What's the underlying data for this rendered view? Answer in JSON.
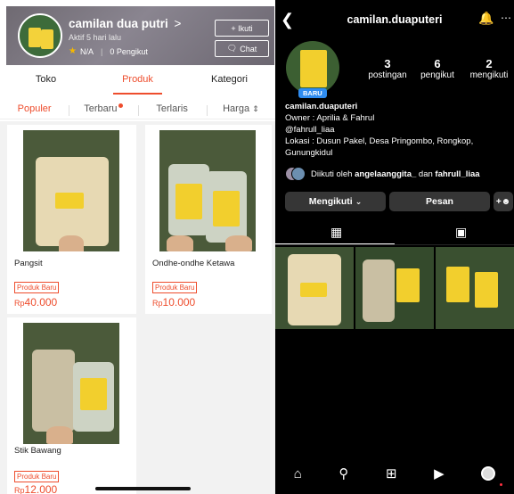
{
  "shopee": {
    "shop_name": "camilan dua putri",
    "name_chevron": ">",
    "active_status": "Aktif 5 hari lalu",
    "rating": "N/A",
    "followers": "0 Pengikut",
    "follow_button": "+ Ikuti",
    "chat_button": "Chat",
    "tabs": [
      "Toko",
      "Produk",
      "Kategori"
    ],
    "active_tab": "Produk",
    "sort_options": [
      "Populer",
      "Terbaru",
      "Terlaris",
      "Harga"
    ],
    "active_sort": "Populer",
    "products": [
      {
        "name": "Pangsit",
        "badge": "Produk Baru",
        "currency": "Rp",
        "price": "40.000"
      },
      {
        "name": "Ondhe-ondhe Ketawa",
        "badge": "Produk Baru",
        "currency": "Rp",
        "price": "10.000"
      },
      {
        "name": "Stik Bawang",
        "badge": "Produk Baru",
        "currency": "Rp",
        "price": "12.000"
      }
    ]
  },
  "instagram": {
    "username": "camilan.duaputeri",
    "avatar_badge": "BARU",
    "stats": [
      {
        "value": "3",
        "label": "postingan"
      },
      {
        "value": "6",
        "label": "pengikut"
      },
      {
        "value": "2",
        "label": "mengikuti"
      }
    ],
    "bio": {
      "name": "camilan.duaputeri",
      "line1": "Owner : Aprilia & Fahrul",
      "line2": "@fahrull_liaa",
      "line3": "Lokasi : Dusun Pakel, Desa Pringombo, Rongkop,",
      "line4": "Gunungkidul"
    },
    "followed_by_prefix": "Diikuti oleh",
    "followed_by_user1": "angelaanggita_",
    "followed_by_mid": "dan",
    "followed_by_user2": "fahrull_liaa",
    "following_button": "Mengikuti",
    "message_button": "Pesan"
  }
}
